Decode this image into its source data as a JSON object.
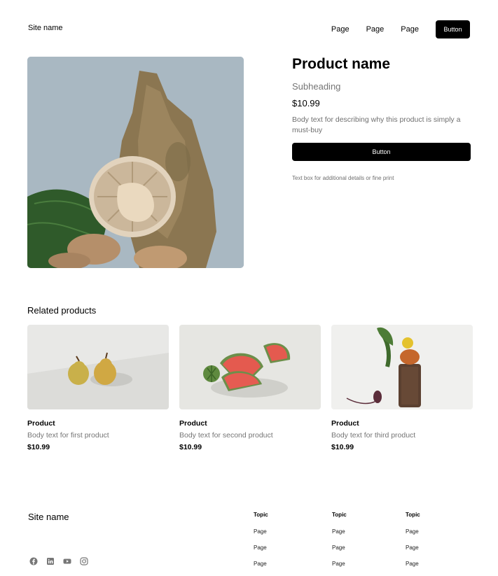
{
  "header": {
    "site_name": "Site name",
    "nav": [
      "Page",
      "Page",
      "Page"
    ],
    "button_label": "Button"
  },
  "product": {
    "title": "Product name",
    "subheading": "Subheading",
    "price": "$10.99",
    "body": "Body text for describing why this product is simply a must-buy",
    "button_label": "Button",
    "fine_print": "Text box for additional details or fine print"
  },
  "related": {
    "title": "Related products",
    "items": [
      {
        "title": "Product",
        "body": "Body text for first product",
        "price": "$10.99"
      },
      {
        "title": "Product",
        "body": "Body text for second product",
        "price": "$10.99"
      },
      {
        "title": "Product",
        "body": "Body text for third product",
        "price": "$10.99"
      }
    ]
  },
  "footer": {
    "site_name": "Site name",
    "columns": [
      {
        "topic": "Topic",
        "links": [
          "Page",
          "Page",
          "Page"
        ]
      },
      {
        "topic": "Topic",
        "links": [
          "Page",
          "Page",
          "Page"
        ]
      },
      {
        "topic": "Topic",
        "links": [
          "Page",
          "Page",
          "Page"
        ]
      }
    ],
    "socials": [
      "facebook-icon",
      "linkedin-icon",
      "youtube-icon",
      "instagram-icon"
    ]
  }
}
